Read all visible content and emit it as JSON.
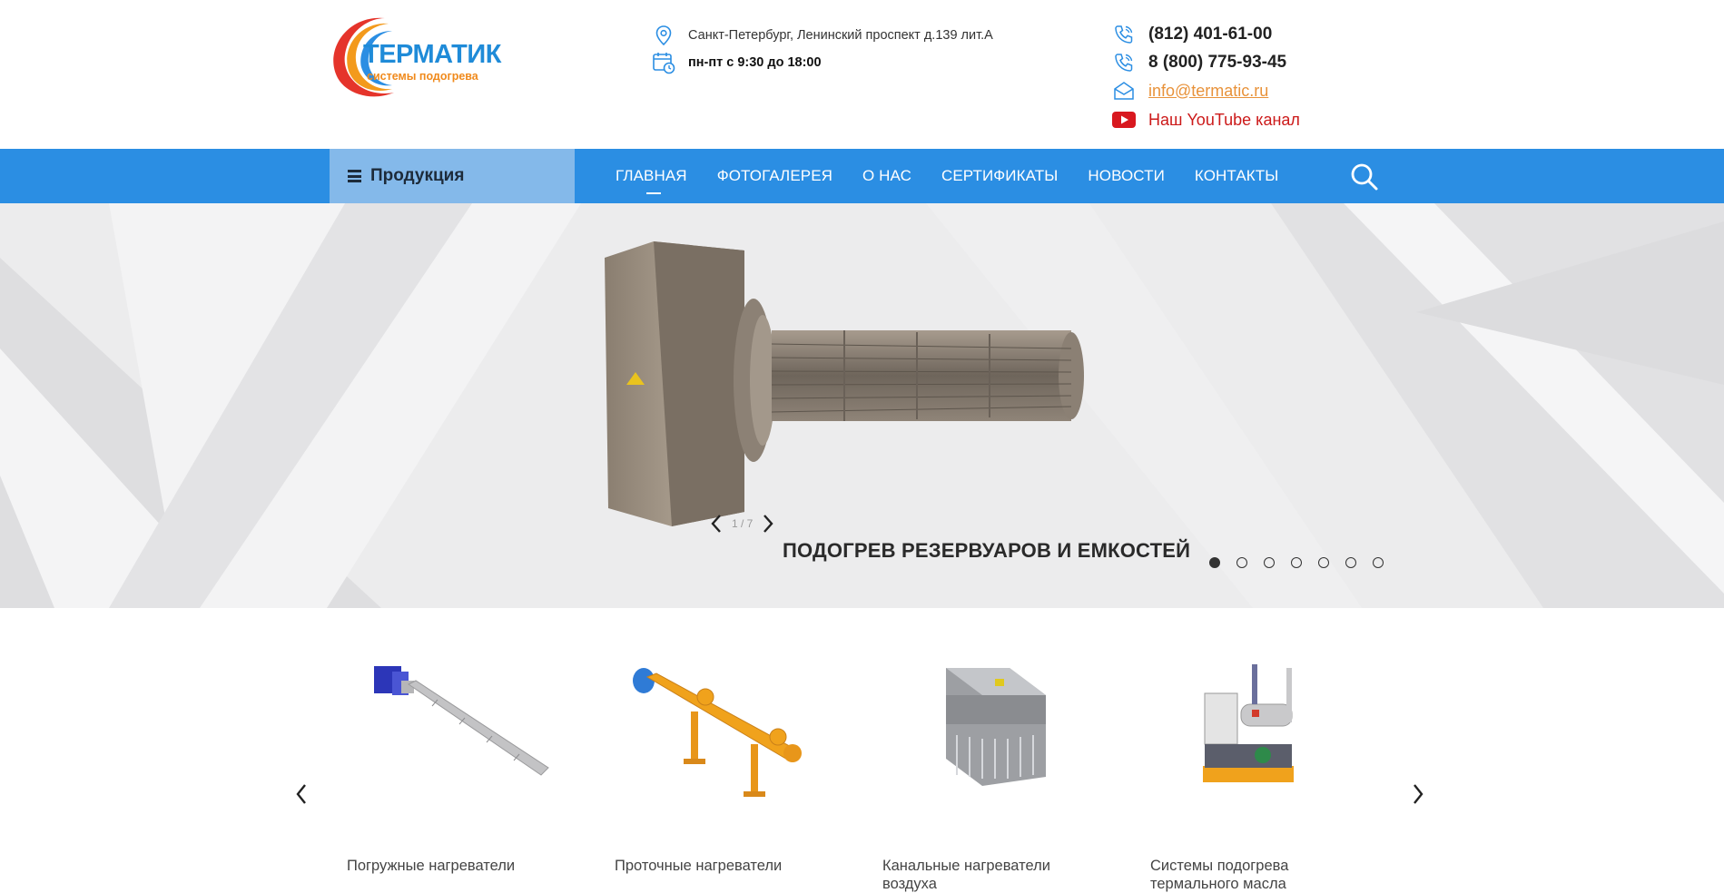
{
  "header": {
    "logo": {
      "title": "ТЕРМАТИК",
      "subtitle": "системы подогрева"
    },
    "address": "Санкт-Петербург, Ленинский проспект д.139 лит.А",
    "hours": "пн-пт с 9:30 до 18:00",
    "phone_1": "(812) 401-61-00",
    "phone_2": "8 (800) 775-93-45",
    "email": "info@termatic.ru",
    "youtube": "Наш YouTube канал"
  },
  "nav": {
    "products_label": "Продукция",
    "items": [
      {
        "label": "ГЛАВНАЯ",
        "active": true
      },
      {
        "label": "ФОТОГАЛЕРЕЯ"
      },
      {
        "label": "О НАС"
      },
      {
        "label": "СЕРТИФИКАТЫ"
      },
      {
        "label": "НОВОСТИ"
      },
      {
        "label": "КОНТАКТЫ"
      }
    ],
    "search_icon": "search-icon"
  },
  "hero": {
    "counter": "1 / 7",
    "title": "ПОДОГРЕВ РЕЗЕРВУАРОВ И ЕМКОСТЕЙ",
    "total_slides": 7,
    "active_slide": 1
  },
  "products": {
    "items": [
      {
        "caption": "Погружные нагреватели"
      },
      {
        "caption": "Проточные нагреватели"
      },
      {
        "caption": "Канальные нагреватели воздуха"
      },
      {
        "caption": "Системы подогрева термального масла"
      }
    ]
  },
  "colors": {
    "accent_blue": "#2b8ee3",
    "products_button": "#84b9ea",
    "email_orange": "#e8923a",
    "youtube_red": "#cc1a1a"
  }
}
